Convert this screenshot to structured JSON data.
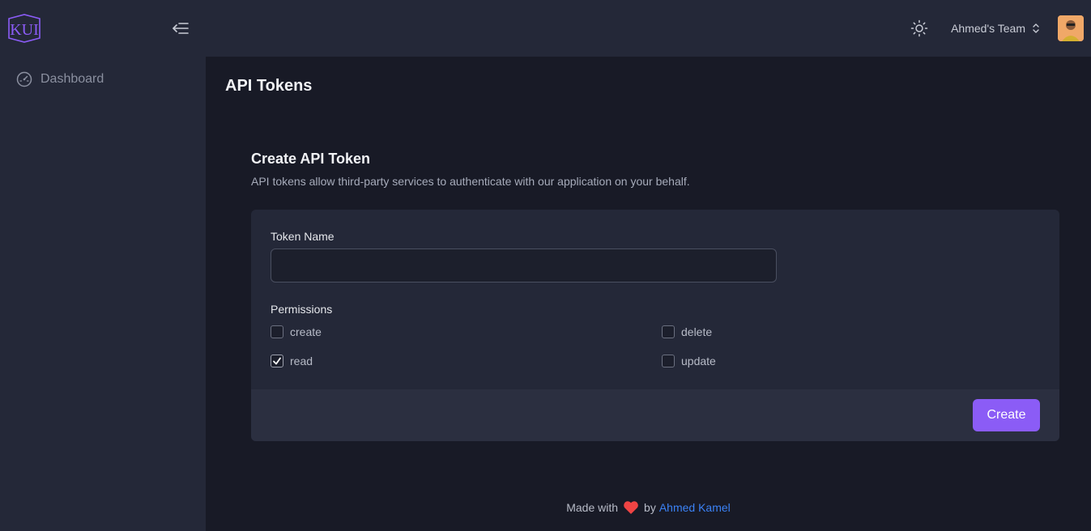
{
  "sidebar": {
    "logo_text": "KUI",
    "items": [
      {
        "label": "Dashboard",
        "icon": "dashboard-gauge-icon"
      }
    ]
  },
  "topbar": {
    "team_name": "Ahmed's Team",
    "theme_icon": "sun-icon"
  },
  "page": {
    "title": "API Tokens",
    "section_title": "Create API Token",
    "section_description": "API tokens allow third-party services to authenticate with our application on your behalf."
  },
  "form": {
    "token_name_label": "Token Name",
    "token_name_value": "",
    "permissions_label": "Permissions",
    "permissions": [
      {
        "label": "create",
        "checked": false
      },
      {
        "label": "delete",
        "checked": false
      },
      {
        "label": "read",
        "checked": true
      },
      {
        "label": "update",
        "checked": false
      }
    ],
    "submit_label": "Create"
  },
  "footer": {
    "prefix": "Made with",
    "by": "by",
    "author": "Ahmed Kamel"
  },
  "colors": {
    "accent": "#8b5cf6",
    "link": "#3b82f6",
    "heart": "#ef4444"
  }
}
